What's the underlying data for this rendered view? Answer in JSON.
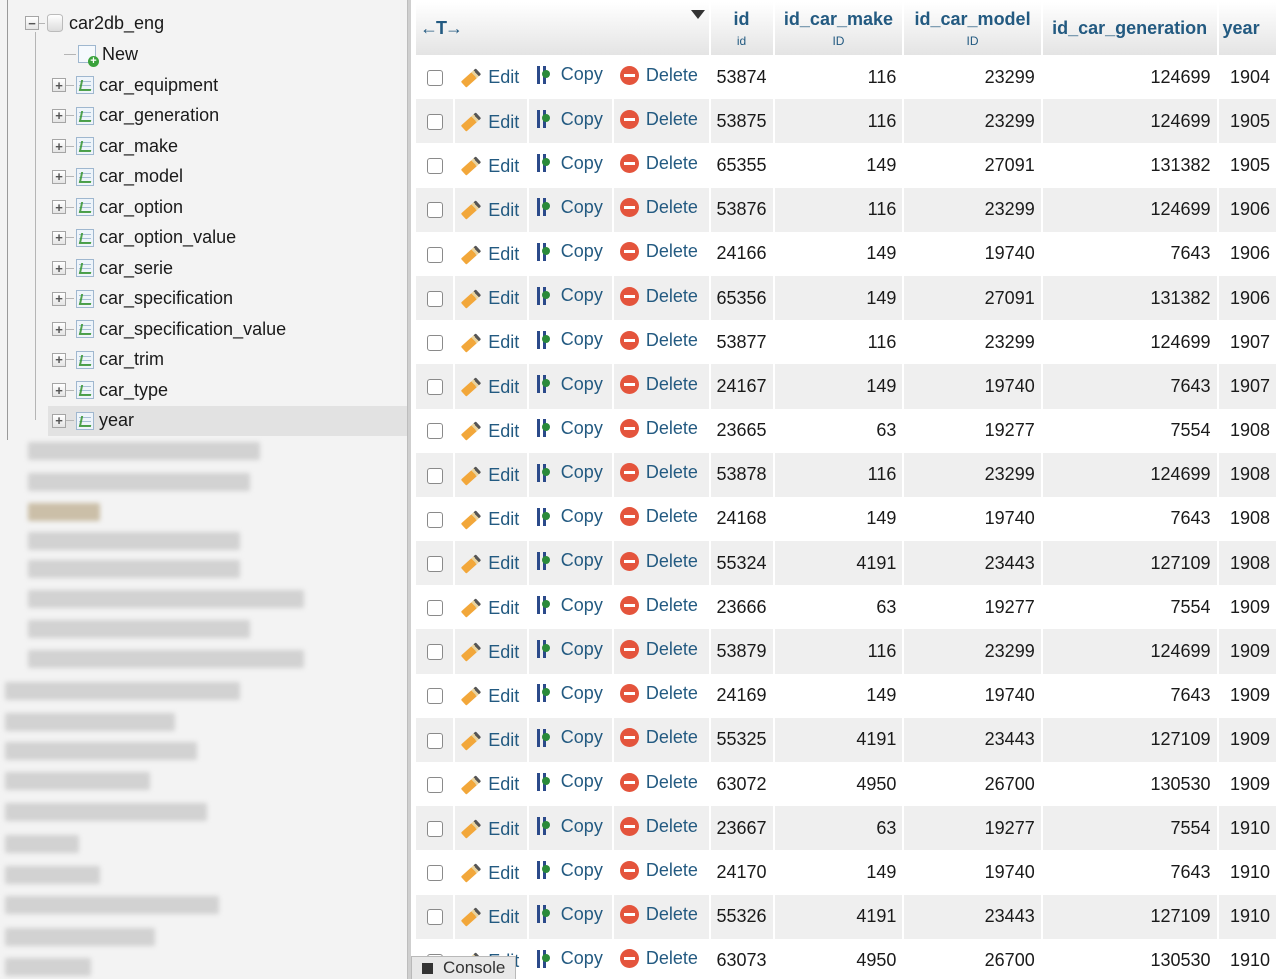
{
  "nav": {
    "database": "car2db_eng",
    "new_label": "New",
    "tables": [
      "car_equipment",
      "car_generation",
      "car_make",
      "car_model",
      "car_option",
      "car_option_value",
      "car_serie",
      "car_specification",
      "car_specification_value",
      "car_trim",
      "car_type",
      "year"
    ],
    "selected_table": "year",
    "expand_symbol": "+",
    "collapse_symbol": "−"
  },
  "table": {
    "arrows_label": "←T→",
    "columns": [
      {
        "label": "id",
        "sub": "id"
      },
      {
        "label": "id_car_make",
        "sub": "ID"
      },
      {
        "label": "id_car_model",
        "sub": "ID"
      },
      {
        "label": "id_car_generation",
        "sub": ""
      },
      {
        "label": "year",
        "sub": ""
      }
    ],
    "actions": {
      "edit": "Edit",
      "copy": "Copy",
      "delete": "Delete"
    },
    "rows": [
      [
        "53874",
        "116",
        "23299",
        "124699",
        "1904"
      ],
      [
        "53875",
        "116",
        "23299",
        "124699",
        "1905"
      ],
      [
        "65355",
        "149",
        "27091",
        "131382",
        "1905"
      ],
      [
        "53876",
        "116",
        "23299",
        "124699",
        "1906"
      ],
      [
        "24166",
        "149",
        "19740",
        "7643",
        "1906"
      ],
      [
        "65356",
        "149",
        "27091",
        "131382",
        "1906"
      ],
      [
        "53877",
        "116",
        "23299",
        "124699",
        "1907"
      ],
      [
        "24167",
        "149",
        "19740",
        "7643",
        "1907"
      ],
      [
        "23665",
        "63",
        "19277",
        "7554",
        "1908"
      ],
      [
        "53878",
        "116",
        "23299",
        "124699",
        "1908"
      ],
      [
        "24168",
        "149",
        "19740",
        "7643",
        "1908"
      ],
      [
        "55324",
        "4191",
        "23443",
        "127109",
        "1908"
      ],
      [
        "23666",
        "63",
        "19277",
        "7554",
        "1909"
      ],
      [
        "53879",
        "116",
        "23299",
        "124699",
        "1909"
      ],
      [
        "24169",
        "149",
        "19740",
        "7643",
        "1909"
      ],
      [
        "55325",
        "4191",
        "23443",
        "127109",
        "1909"
      ],
      [
        "63072",
        "4950",
        "26700",
        "130530",
        "1909"
      ],
      [
        "23667",
        "63",
        "19277",
        "7554",
        "1910"
      ],
      [
        "24170",
        "149",
        "19740",
        "7643",
        "1910"
      ],
      [
        "55326",
        "4191",
        "23443",
        "127109",
        "1910"
      ],
      [
        "63073",
        "4950",
        "26700",
        "130530",
        "1910"
      ]
    ]
  },
  "console": {
    "label": "Console"
  }
}
